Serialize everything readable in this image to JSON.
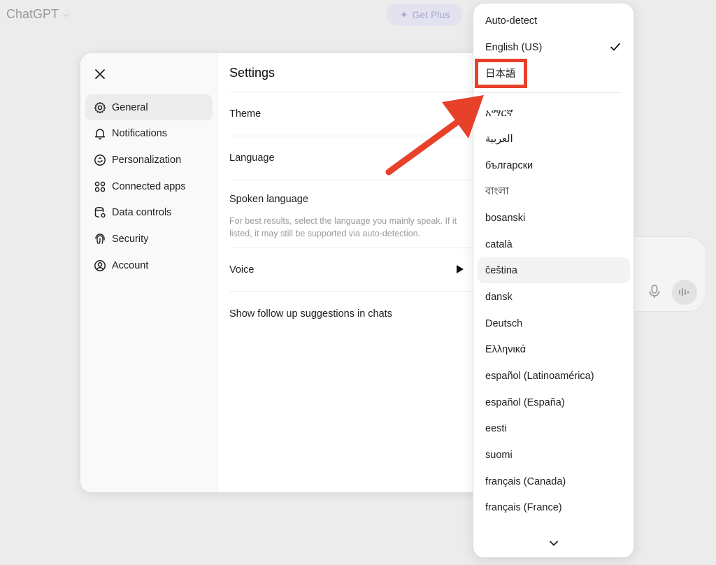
{
  "app": {
    "title": "ChatGPT",
    "get_plus_label": "Get Plus"
  },
  "settings": {
    "title": "Settings",
    "nav": [
      {
        "label": "General",
        "icon": "gear-icon",
        "active": true
      },
      {
        "label": "Notifications",
        "icon": "bell-icon"
      },
      {
        "label": "Personalization",
        "icon": "personalization-icon"
      },
      {
        "label": "Connected apps",
        "icon": "apps-icon"
      },
      {
        "label": "Data controls",
        "icon": "data-controls-icon"
      },
      {
        "label": "Security",
        "icon": "fingerprint-icon"
      },
      {
        "label": "Account",
        "icon": "user-circle-icon"
      }
    ],
    "rows": {
      "theme": "Theme",
      "language": "Language",
      "spoken_language": "Spoken language",
      "spoken_help_line1": "For best results, select the language you mainly speak. If it",
      "spoken_help_line2": "listed, it may still be supported via auto-detection.",
      "voice": "Voice",
      "followups": "Show follow up suggestions in chats"
    }
  },
  "language_menu": {
    "selected": "English (US)",
    "highlighted": "日本語",
    "top_options": [
      "Auto-detect",
      "English (US)",
      "日本語"
    ],
    "options": [
      "አማርኛ",
      "العربية",
      "български",
      "বাংলা",
      "bosanski",
      "català",
      "čeština",
      "dansk",
      "Deutsch",
      "Ελληνικά",
      "español (Latinoamérica)",
      "español (España)",
      "eesti",
      "suomi",
      "français (Canada)",
      "français (France)"
    ],
    "hovered": "čeština"
  },
  "colors": {
    "annotation": "#e8412a",
    "accent_plus": "#a9a6cf"
  }
}
